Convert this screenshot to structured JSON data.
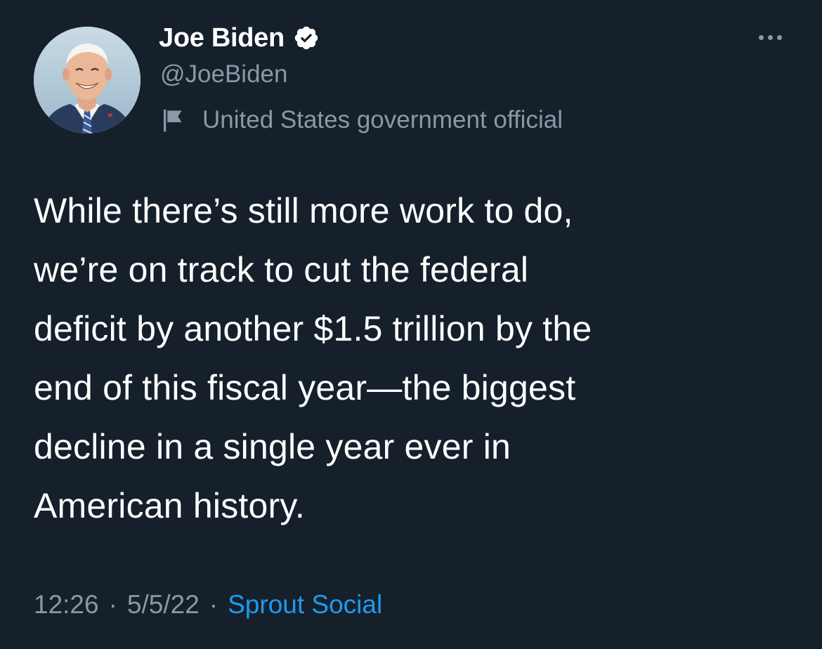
{
  "tweet": {
    "author": {
      "display_name": "Joe Biden",
      "handle": "@JoeBiden",
      "verified_icon": "verified-badge-icon",
      "label": "United States government official",
      "label_icon": "flag-icon",
      "avatar_icon": "avatar-photo"
    },
    "more_icon": "more-options-icon",
    "text": "While there’s still more work to do,\nwe’re on track to cut the federal\ndeficit by another $1.5 trillion by the\nend of this fiscal year—the biggest\ndecline in a single year ever in\nAmerican history.",
    "meta": {
      "time": "12:26",
      "separator": "·",
      "date": "5/5/22",
      "source": "Sprout Social"
    }
  },
  "colors": {
    "background": "#15202b",
    "primary_text": "#ffffff",
    "secondary_text": "#8b98a5",
    "link": "#1d9bf0"
  }
}
